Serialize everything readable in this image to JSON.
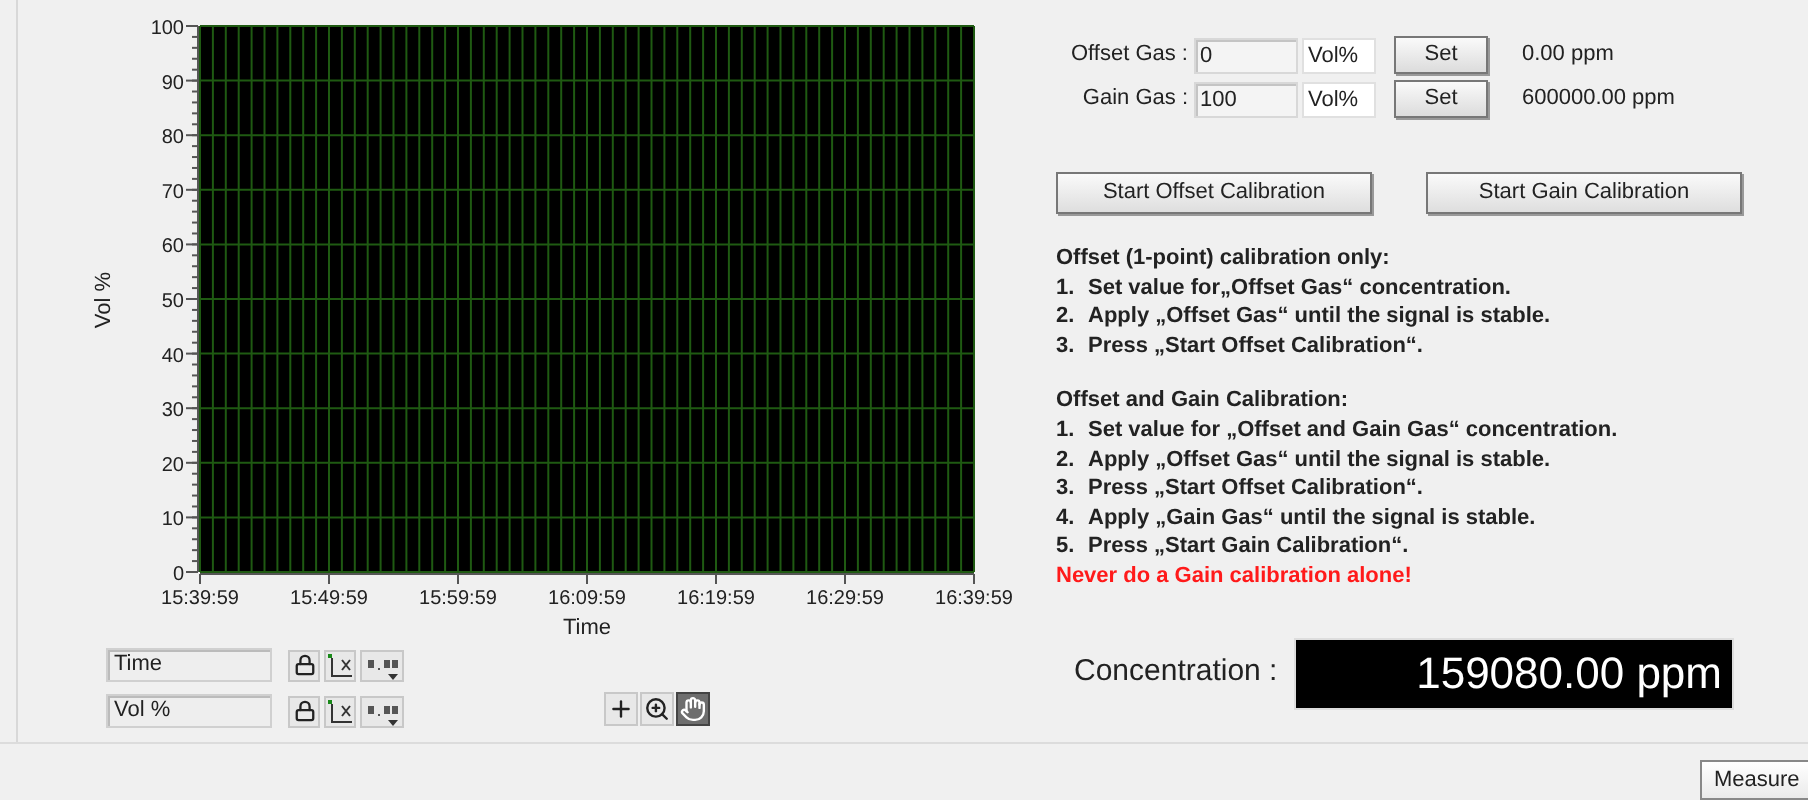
{
  "chart": {
    "chart_data": {
      "type": "line",
      "xlabel": "Time",
      "ylabel": "Vol %",
      "grid": true,
      "ylim": [
        0,
        100
      ],
      "yticks": [
        0,
        10,
        20,
        30,
        40,
        50,
        60,
        70,
        80,
        90,
        100
      ],
      "categories": [
        "15:39:59",
        "15:49:59",
        "15:59:59",
        "16:09:59",
        "16:19:59",
        "16:29:59",
        "16:39:59"
      ]
    }
  },
  "scale_legend": [
    {
      "name": "Time"
    },
    {
      "name": "Vol %"
    }
  ],
  "graph_tools": [
    {
      "kind": "cursor",
      "selected": false
    },
    {
      "kind": "zoom",
      "selected": false
    },
    {
      "kind": "pan",
      "selected": true
    }
  ],
  "gas_settings": [
    {
      "label": "Offset Gas :",
      "value": "0",
      "unit": "Vol%",
      "button": "Set",
      "reading": "0.00 ppm"
    },
    {
      "label": "Gain Gas :",
      "value": "100",
      "unit": "Vol%",
      "button": "Set",
      "reading": "600000.00 ppm"
    }
  ],
  "calibration_buttons": [
    "Start Offset Calibration",
    "Start Gain Calibration"
  ],
  "instructions": [
    {
      "title": "Offset (1-point) calibration only:",
      "steps": [
        {
          "number": "1.",
          "text": "Set value for„Offset Gas“ concentration."
        },
        {
          "number": "2.",
          "text": "Apply „Offset Gas“ until the signal is stable."
        },
        {
          "number": "3.",
          "text": "Press „Start Offset Calibration“."
        }
      ]
    },
    {
      "title": "Offset and Gain Calibration:",
      "steps": [
        {
          "number": "1.",
          "text": "Set value for „Offset and Gain Gas“ concentration."
        },
        {
          "number": "2.",
          "text": "Apply „Offset Gas“ until the signal is stable."
        },
        {
          "number": "3.",
          "text": "Press „Start Offset Calibration“."
        },
        {
          "number": "4.",
          "text": "Apply „Gain Gas“ until the signal is stable."
        },
        {
          "number": "5.",
          "text": "Press „Start Gain Calibration“."
        }
      ]
    }
  ],
  "warning": "Never do a Gain calibration alone!",
  "concentration": {
    "label": "Concentration :",
    "value": "159080.00 ppm"
  },
  "measure_button": "Measure"
}
